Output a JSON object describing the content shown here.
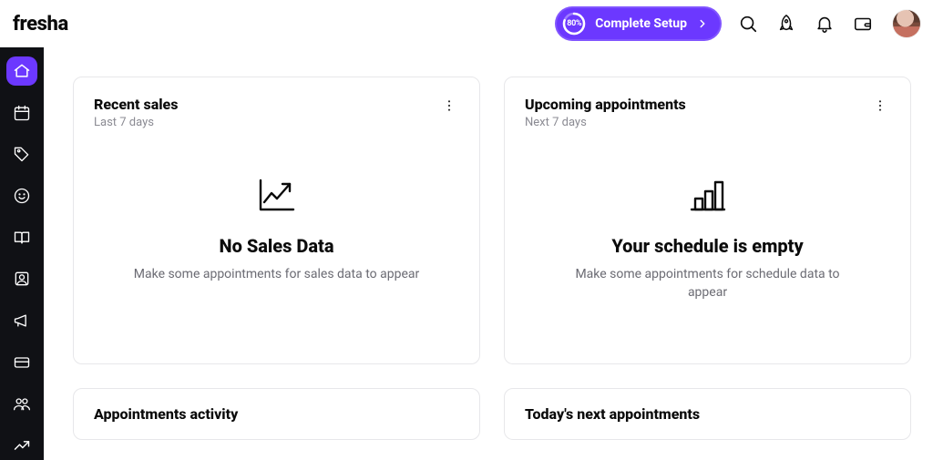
{
  "brand": "fresha",
  "setup": {
    "percent": "80%",
    "label": "Complete Setup"
  },
  "dashboard": {
    "recent_sales": {
      "title": "Recent sales",
      "subtitle": "Last 7 days",
      "empty_title": "No Sales Data",
      "empty_desc": "Make some appointments for sales data to appear"
    },
    "upcoming": {
      "title": "Upcoming appointments",
      "subtitle": "Next 7 days",
      "empty_title": "Your schedule is empty",
      "empty_desc": "Make some appointments for schedule data to appear"
    },
    "activity": {
      "title": "Appointments activity"
    },
    "today": {
      "title": "Today's next appointments"
    }
  }
}
